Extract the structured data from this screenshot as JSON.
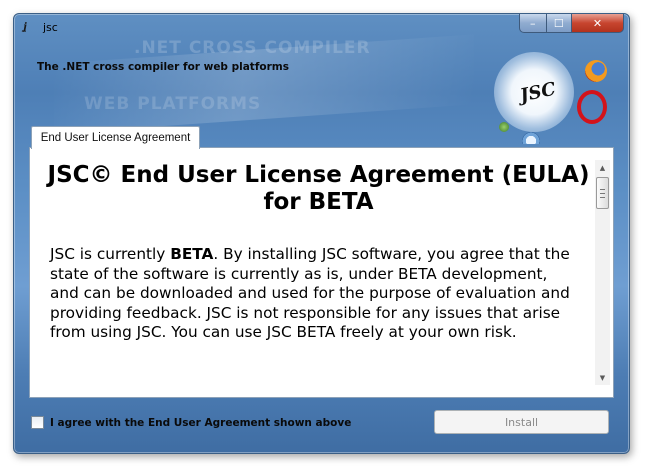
{
  "window": {
    "title": "jsc",
    "app_icon_glyph": "ʝ",
    "caption": {
      "minimize": "–",
      "maximize": "☐",
      "close": "✕"
    }
  },
  "banner": {
    "subtitle": "The .NET cross compiler for web platforms",
    "ghost_line_1": ".NET CROSS COMPILER",
    "ghost_line_2": "WEB PLATFORMS",
    "logo_text": "JSC",
    "icons": [
      "firefox-icon",
      "opera-icon",
      "chrome-icon",
      "safari-icon"
    ]
  },
  "tabs": [
    {
      "label": "End User License Agreement",
      "selected": true
    }
  ],
  "eula": {
    "title": "JSC© End User License Agreement (EULA) for BETA",
    "para_prefix": "JSC is currently ",
    "para_bold": "BETA",
    "para_rest": ". By installing JSC software, you agree that the state of the software is currently as is, under BETA development, and can be downloaded and used for the purpose of evaluation and providing feedback. JSC is not responsible for any issues that arise from using JSC. You can use JSC BETA freely at your own risk."
  },
  "scrollbar": {
    "up_arrow": "▲",
    "down_arrow": "▼"
  },
  "footer": {
    "agree_label": "I agree with the End User Agreement shown above",
    "agree_checked": false,
    "install_label": "Install",
    "install_enabled": false
  },
  "colors": {
    "window_blue": "#5c8fc5",
    "close_red": "#c7452f",
    "panel_border": "#8da2b8"
  }
}
